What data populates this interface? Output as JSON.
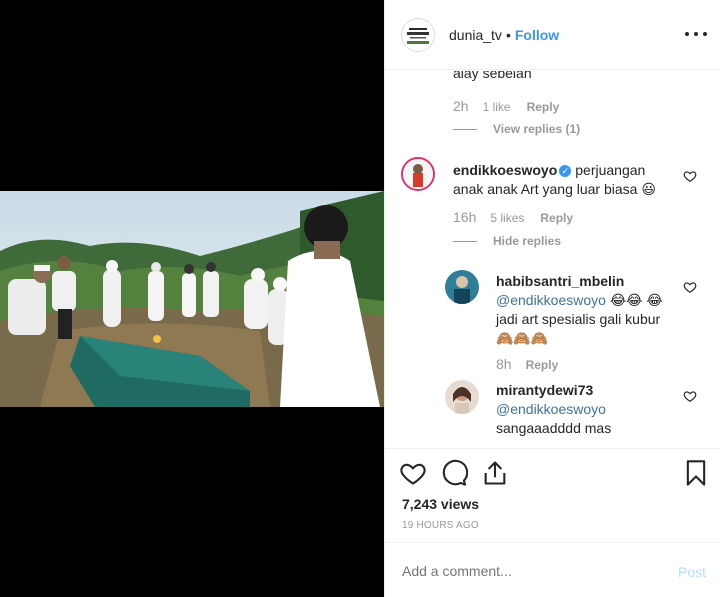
{
  "header": {
    "username": "dunia_tv",
    "separator": "•",
    "follow_label": "Follow",
    "more_icon": "more-options-icon"
  },
  "comments": {
    "cut_off_text": "alay sebelah",
    "first_meta": {
      "time": "2h",
      "likes": "1 like",
      "reply": "Reply"
    },
    "view_replies": "View replies (1)",
    "main": {
      "username": "endikkoeswoyo",
      "text": "perjuangan anak anak Art yang luar biasa 😃",
      "time": "16h",
      "likes": "5 likes",
      "reply": "Reply",
      "hide_replies": "Hide replies"
    },
    "replies": [
      {
        "username": "habibsantri_mbelin",
        "mention": "@endikkoeswoyo",
        "text": "😂😂 😂 jadi art spesialis gali kubur 🙈🙈🙈",
        "time": "8h",
        "reply": "Reply"
      },
      {
        "username": "mirantydewi73",
        "mention": "@endikkoeswoyo",
        "text": "sangaaadddd mas"
      }
    ]
  },
  "actions": {
    "views": "7,243 views",
    "posted_ago": "19 HOURS AGO"
  },
  "add_comment": {
    "placeholder": "Add a comment...",
    "post_label": "Post"
  },
  "colors": {
    "link_blue": "#3897f0",
    "mention_blue": "#3f729b",
    "muted_gray": "#999999",
    "post_disabled": "#b2dffc"
  }
}
